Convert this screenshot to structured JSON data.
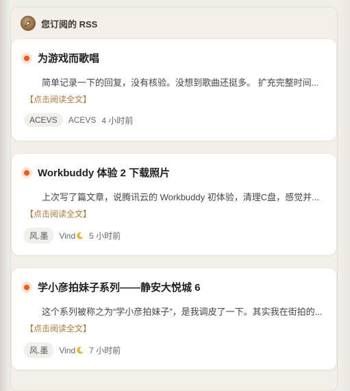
{
  "header": {
    "title": "您订阅的 RSS"
  },
  "posts": [
    {
      "title": "为游戏而歌唱",
      "excerpt": "简单记录一下的回复，没有核验。没想到歌曲还挺多。 扩充完整时间...",
      "read_more": "【点击阅读全文】",
      "tag": "ACEVS",
      "author": "ACEVS",
      "time": "4 小时前"
    },
    {
      "title": "Workbuddy 体验 2 下载照片",
      "excerpt": "上次写了篇文章，说腾讯云的 Workbuddy 初体验，清理C盘，感觉并...",
      "read_more": "【点击阅读全文】",
      "tag": "风.墨",
      "author": "Vind",
      "time": "5 小时前"
    },
    {
      "title": "学小彦拍妹子系列——静安大悦城 6",
      "excerpt": "这个系列被称之为“学小彦拍妹子”，是我调皮了一下。其实我在街拍的...",
      "read_more": "【点击阅读全文】",
      "tag": "风.墨",
      "author": "Vind",
      "time": "7 小时前"
    }
  ],
  "icons": {
    "header": "rss-avatar-icon",
    "post_marker": "orange-dot-icon",
    "author_emoji": "crescent-moon-icon"
  },
  "colors": {
    "accent": "#f05a1a",
    "read_more": "#b0773a",
    "panel_bg": "#f3f0ea"
  }
}
